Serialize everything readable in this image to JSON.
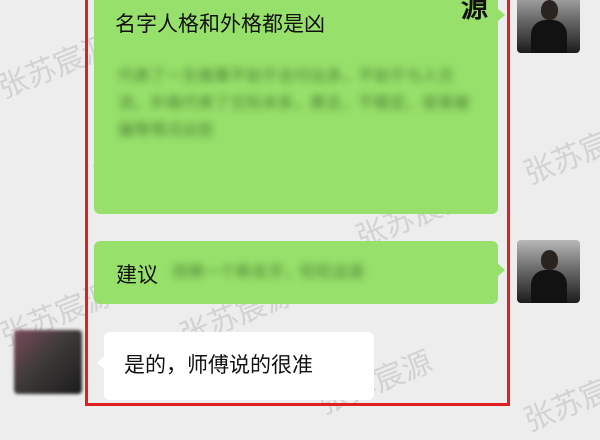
{
  "messages": [
    {
      "side": "right",
      "text": "名字人格和外格都是凶",
      "blurred": "代表了一生做事不如于总付出多，不如于与人交流，外格代表了交际关系，察言，不稳定，容易被骗等情况出些"
    },
    {
      "side": "right",
      "text": "建议",
      "blurred": "改换一个新名字，旺旺运道"
    },
    {
      "side": "left",
      "text": "是的，师傅说的很准"
    }
  ],
  "watermark": "张苏宸源",
  "top_glyph": "源"
}
